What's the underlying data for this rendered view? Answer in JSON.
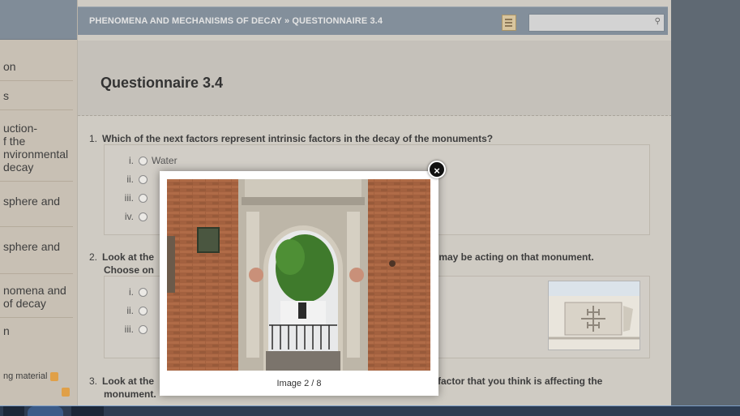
{
  "header": {
    "breadcrumb": "PHENOMENA AND MECHANISMS OF DECAY » QUESTIONNAIRE 3.4",
    "search_placeholder": ""
  },
  "sidebar": {
    "items": [
      {
        "label": "on"
      },
      {
        "label": "s"
      },
      {
        "label": "uction-\nf the\nnvironmental\n decay"
      },
      {
        "label": "sphere and"
      },
      {
        "label": "sphere and"
      },
      {
        "label": "nomena and\n of decay"
      },
      {
        "label": "n"
      },
      {
        "label": "ng material"
      }
    ]
  },
  "main": {
    "title": "Questionnaire 3.4",
    "questions": [
      {
        "num": "1.",
        "text": "Which of the next factors represent intrinsic factors in the decay of the monuments?",
        "options": [
          {
            "roman": "i.",
            "label": "Water"
          },
          {
            "roman": "ii.",
            "label": ""
          },
          {
            "roman": "iii.",
            "label": ""
          },
          {
            "roman": "iv.",
            "label": ""
          }
        ]
      },
      {
        "num": "2.",
        "text_left": "Look at the",
        "text_right": "or may be acting on that monument.",
        "text_line2": "Choose on",
        "options": [
          {
            "roman": "i.",
            "label": ""
          },
          {
            "roman": "ii.",
            "label": ""
          },
          {
            "roman": "iii.",
            "label": ""
          }
        ]
      },
      {
        "num": "3.",
        "text_left": "Look at the",
        "text_right": "factor that you think is affecting the",
        "text_line2": "monument."
      }
    ]
  },
  "modal": {
    "caption": "Image 2 / 8",
    "close_label": "×"
  },
  "colors": {
    "header_bg": "#838f9b",
    "main_bg": "#cfcbc3",
    "sidebar_bg": "#c8c0b4",
    "modal_bg": "#ffffff"
  },
  "icons": [
    "search-icon",
    "document-icon",
    "close-icon",
    "material-icon"
  ]
}
